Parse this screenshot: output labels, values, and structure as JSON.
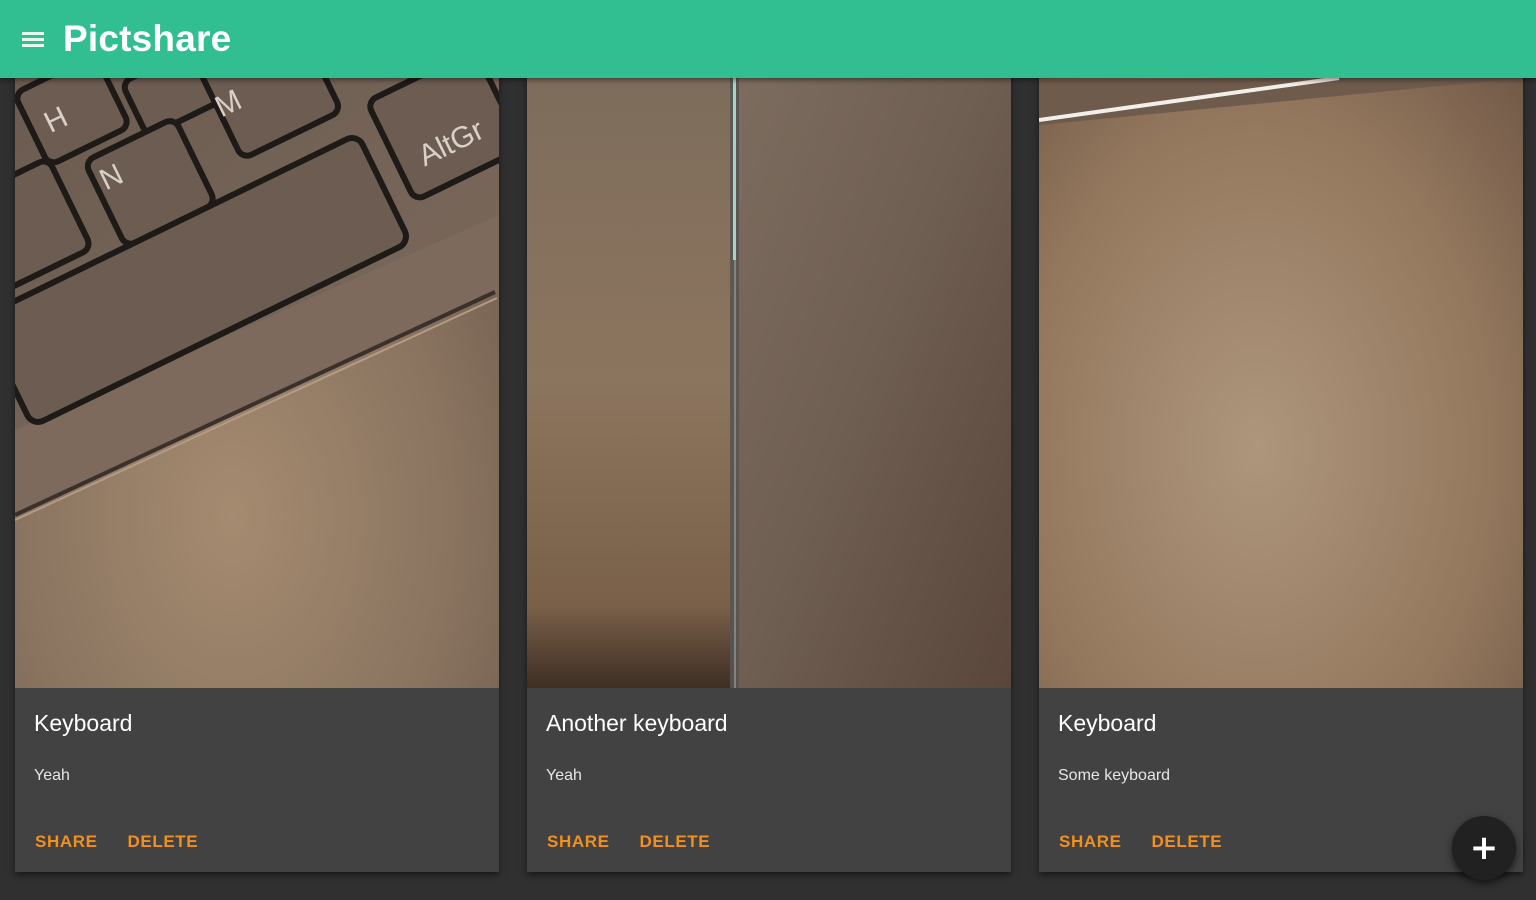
{
  "app": {
    "title": "Pictshare",
    "menu_icon": "hamburger-menu-icon",
    "accent_color": "#31be90",
    "action_color": "#f28f1e"
  },
  "cards": [
    {
      "image": "keyboard-photo",
      "title": "Keyboard",
      "description": "Yeah",
      "key_labels": [
        "H",
        "N",
        "M",
        "AltGr"
      ],
      "share_label": "SHARE",
      "delete_label": "DELETE"
    },
    {
      "image": "another-keyboard-photo",
      "title": "Another keyboard",
      "description": "Yeah",
      "share_label": "SHARE",
      "delete_label": "DELETE"
    },
    {
      "image": "keyboard-photo-2",
      "title": "Keyboard",
      "description": "Some keyboard",
      "share_label": "SHARE",
      "delete_label": "DELETE"
    }
  ],
  "fab": {
    "label": "+",
    "icon": "add-icon"
  }
}
